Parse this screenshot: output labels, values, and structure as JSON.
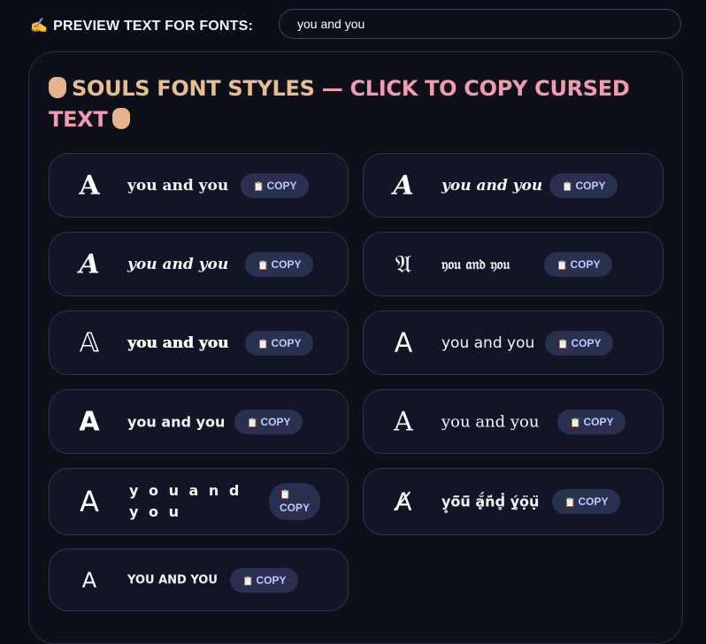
{
  "preview": {
    "icon": "✍",
    "label": "PREVIEW TEXT FOR FONTS:",
    "value": "you and you"
  },
  "heading": {
    "part1": "SOULS FONT STYLES",
    "separator": " — ",
    "part2": "CLICK TO COPY CURSED TEXT",
    "icon": "raised-hand"
  },
  "colors": {
    "heading_primary": "#e9bd8e",
    "heading_secondary": "#f19ab0",
    "copy_button_bg": "#2a3050",
    "copy_button_text": "#c7c8ff",
    "card_bg": "#121526"
  },
  "copy_icon": "📋",
  "copy_label": "COPY",
  "cards": [
    {
      "glyph": "A",
      "text": "you and you",
      "style": "bold serif"
    },
    {
      "glyph": "A",
      "text": "you and you",
      "style": "bold italic serif"
    },
    {
      "glyph": "A",
      "text": "you and you",
      "style": "bold italic serif"
    },
    {
      "glyph": "𝔄",
      "text": "𝔶𝔬𝔲 𝔞𝔫𝔡 𝔶𝔬𝔲",
      "style": "fraktur"
    },
    {
      "glyph": "𝔸",
      "text": "you and you",
      "style": "double-struck"
    },
    {
      "glyph": "A",
      "text": "you and you",
      "style": "sans"
    },
    {
      "glyph": "A",
      "text": "you and you",
      "style": "bold sans"
    },
    {
      "glyph": "A",
      "text": "you and you",
      "style": "serif"
    },
    {
      "glyph": "A",
      "text": "y o u a n d y o u",
      "style": "spaced"
    },
    {
      "glyph": "A̸",
      "text": "y̥ö̈ü̈ ḁ̆́n̈́ḋ̥ ý̥ọ̈ụ̈",
      "style": "cursed"
    },
    {
      "glyph": "A",
      "text": "YOU AND YOU",
      "style": "small caps"
    }
  ]
}
